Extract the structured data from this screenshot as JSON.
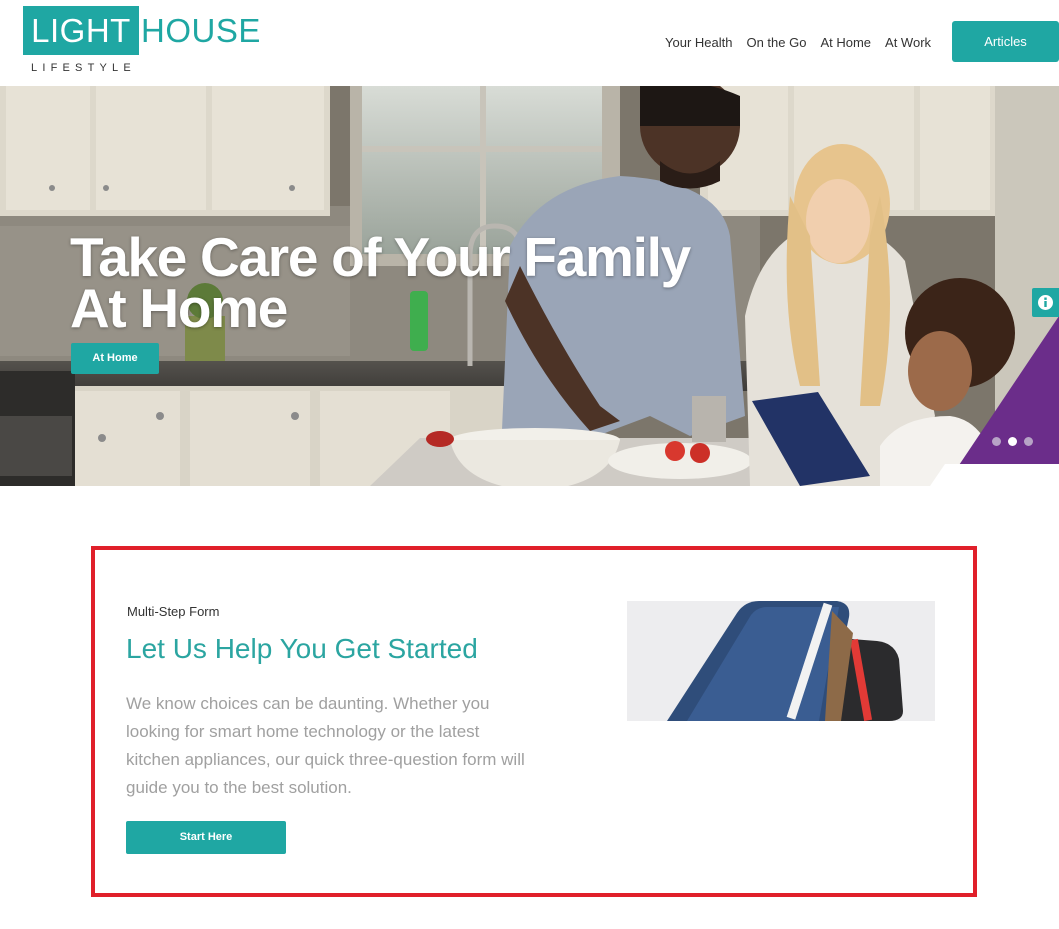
{
  "header": {
    "logo": {
      "part1": "LIGHT",
      "part2": "HOUSE",
      "tagline": "LIFESTYLE"
    },
    "nav": [
      {
        "label": "Your Health"
      },
      {
        "label": "On the Go"
      },
      {
        "label": "At Home"
      },
      {
        "label": "At Work"
      }
    ],
    "cta_label": "Articles"
  },
  "hero": {
    "title_line1": "Take Care of Your Family",
    "title_line2": "At Home",
    "button_label": "At Home",
    "slides_total": 3,
    "active_slide": 2
  },
  "section": {
    "eyebrow": "Multi-Step Form",
    "title": "Let Us Help You Get Started",
    "body": "We know choices can be daunting. Whether you looking for smart home technology or the latest kitchen appliances, our quick three-question form will guide you to the best solution.",
    "button_label": "Start Here"
  },
  "colors": {
    "accent": "#1fa7a3",
    "title_teal": "#2ba5a1",
    "highlight_outline": "#e0202a",
    "hero_purple": "#6b2d8a"
  },
  "icons": {
    "info": "info-icon"
  }
}
